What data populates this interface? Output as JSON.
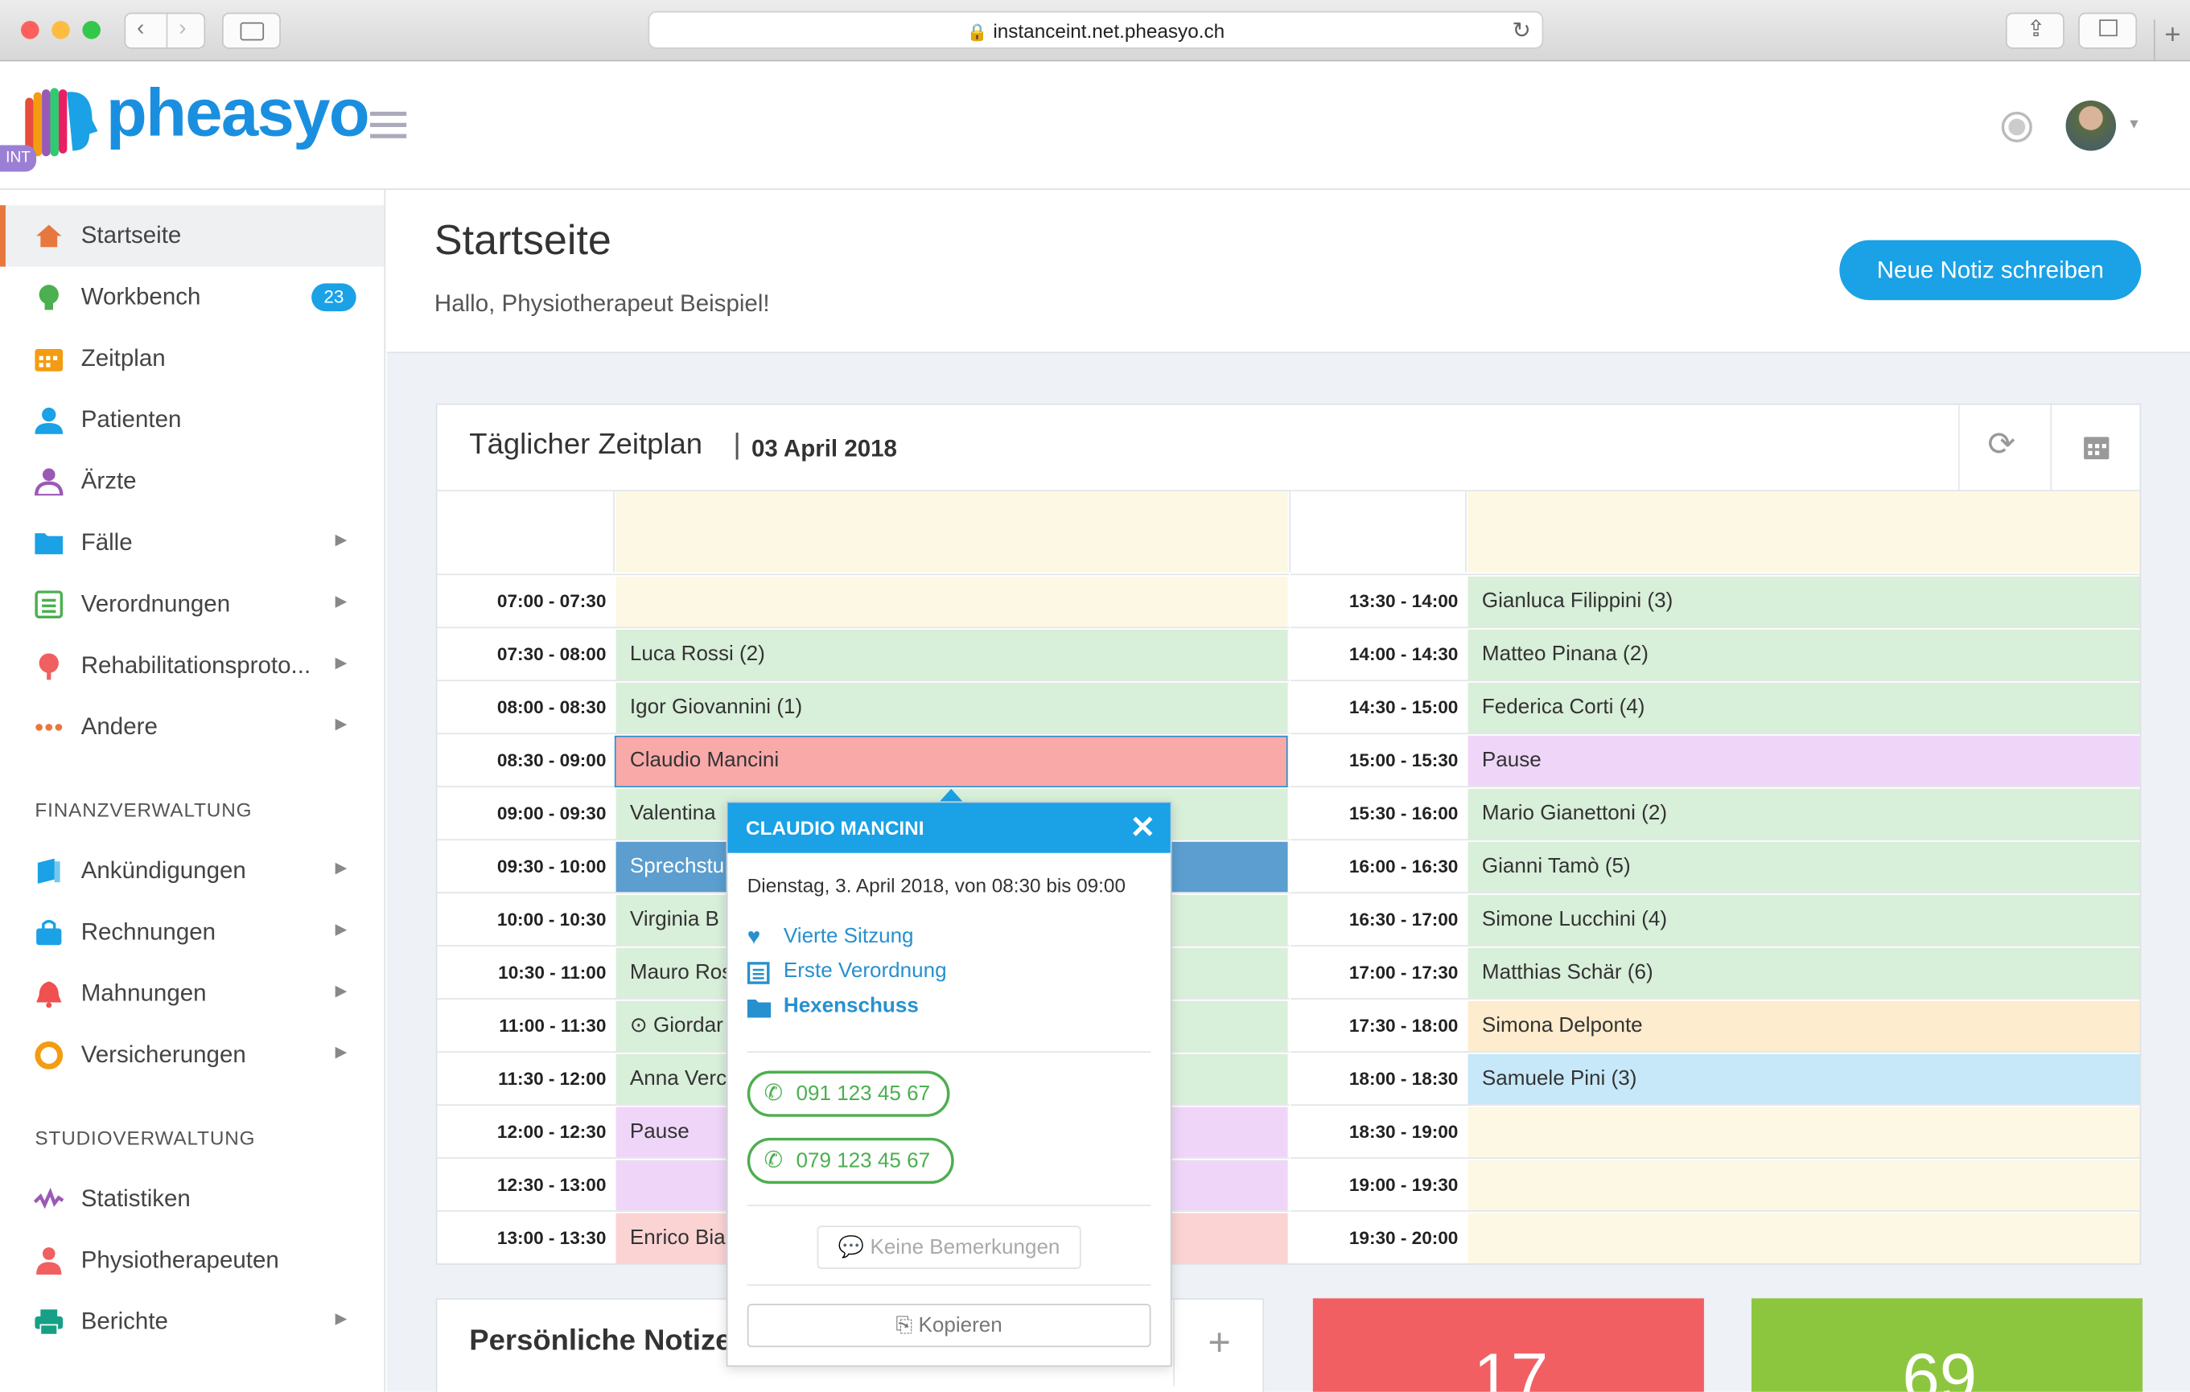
{
  "browser": {
    "url": "instanceint.net.pheasyo.ch"
  },
  "header": {
    "logo": "pheasyo",
    "badge": "INT"
  },
  "sidebar": {
    "items": [
      {
        "label": "Startseite",
        "icon": "home-icon",
        "color": "#e8773d"
      },
      {
        "label": "Workbench",
        "icon": "lightbulb-icon",
        "color": "#4caf50",
        "badge": "23"
      },
      {
        "label": "Zeitplan",
        "icon": "calendar-icon",
        "color": "#f39c12"
      },
      {
        "label": "Patienten",
        "icon": "user-icon",
        "color": "#1aa1e6"
      },
      {
        "label": "Ärzte",
        "icon": "doctor-icon",
        "color": "#9b59b6"
      },
      {
        "label": "Fälle",
        "icon": "folder-icon",
        "color": "#1aa1e6"
      },
      {
        "label": "Verordnungen",
        "icon": "list-icon",
        "color": "#4caf50"
      },
      {
        "label": "Rehabilitationsproto...",
        "icon": "tree-icon",
        "color": "#f06060"
      },
      {
        "label": "Andere",
        "icon": "dots-icon",
        "color": "#e8773d"
      }
    ],
    "section_finance": "FINANZVERWALTUNG",
    "finance_items": [
      {
        "label": "Ankündigungen",
        "icon": "book-icon",
        "color": "#1aa1e6"
      },
      {
        "label": "Rechnungen",
        "icon": "bag-icon",
        "color": "#1aa1e6"
      },
      {
        "label": "Mahnungen",
        "icon": "bell-icon",
        "color": "#f05050"
      },
      {
        "label": "Versicherungen",
        "icon": "lifebuoy-icon",
        "color": "#f39c12"
      }
    ],
    "section_studio": "STUDIOVERWALTUNG",
    "studio_items": [
      {
        "label": "Statistiken",
        "icon": "wave-icon",
        "color": "#9b59b6"
      },
      {
        "label": "Physiotherapeuten",
        "icon": "therapist-icon",
        "color": "#f06060"
      },
      {
        "label": "Berichte",
        "icon": "printer-icon",
        "color": "#16a085"
      }
    ]
  },
  "page": {
    "title": "Startseite",
    "greeting": "Hallo, Physiotherapeut Beispiel!",
    "new_note_button": "Neue Notiz schreiben"
  },
  "schedule": {
    "title": "Täglicher Zeitplan",
    "separator": "|",
    "date": "03 April 2018",
    "left": [
      {
        "time": "07:00 - 07:30",
        "text": "",
        "color": "yellow"
      },
      {
        "time": "07:30 - 08:00",
        "text": "Luca Rossi (2)",
        "color": "green"
      },
      {
        "time": "08:00 - 08:30",
        "text": "Igor Giovannini (1)",
        "color": "green"
      },
      {
        "time": "08:30 - 09:00",
        "text": "Claudio Mancini",
        "color": "red"
      },
      {
        "time": "09:00 - 09:30",
        "text": "Valentina",
        "color": "green"
      },
      {
        "time": "09:30 - 10:00",
        "text": "Sprechstu",
        "color": "blue"
      },
      {
        "time": "10:00 - 10:30",
        "text": "Virginia B",
        "color": "green"
      },
      {
        "time": "10:30 - 11:00",
        "text": "Mauro Ros",
        "color": "green"
      },
      {
        "time": "11:00 - 11:30",
        "text": "⊙ Giordar",
        "color": "green"
      },
      {
        "time": "11:30 - 12:00",
        "text": "Anna Verc",
        "color": "green"
      },
      {
        "time": "12:00 - 12:30",
        "text": "Pause",
        "color": "purple"
      },
      {
        "time": "12:30 - 13:00",
        "text": "",
        "color": "purple"
      },
      {
        "time": "13:00 - 13:30",
        "text": "Enrico Bia",
        "color": "pink"
      }
    ],
    "right": [
      {
        "time": "13:30 - 14:00",
        "text": "Gianluca Filippini (3)",
        "color": "green"
      },
      {
        "time": "14:00 - 14:30",
        "text": "Matteo Pinana (2)",
        "color": "green"
      },
      {
        "time": "14:30 - 15:00",
        "text": "Federica Corti (4)",
        "color": "green"
      },
      {
        "time": "15:00 - 15:30",
        "text": "Pause",
        "color": "purple"
      },
      {
        "time": "15:30 - 16:00",
        "text": "Mario Gianettoni (2)",
        "color": "green"
      },
      {
        "time": "16:00 - 16:30",
        "text": "Gianni Tamò (5)",
        "color": "green"
      },
      {
        "time": "16:30 - 17:00",
        "text": "Simone Lucchini (4)",
        "color": "green"
      },
      {
        "time": "17:00 - 17:30",
        "text": "Matthias Schär (6)",
        "color": "green"
      },
      {
        "time": "17:30 - 18:00",
        "text": "Simona Delponte",
        "color": "orange"
      },
      {
        "time": "18:00 - 18:30",
        "text": "Samuele Pini (3)",
        "color": "lightblue"
      },
      {
        "time": "18:30 - 19:00",
        "text": "",
        "color": "yellow"
      },
      {
        "time": "19:00 - 19:30",
        "text": "",
        "color": "yellow"
      },
      {
        "time": "19:30 - 20:00",
        "text": "",
        "color": "yellow"
      }
    ]
  },
  "popup": {
    "name": "CLAUDIO MANCINI",
    "datetime": "Dienstag, 3. April 2018, von 08:30 bis 09:00",
    "session": "Vierte Sitzung",
    "prescription": "Erste Verordnung",
    "case": "Hexenschuss",
    "phone1": "091 123 45 67",
    "phone2": "079 123 45 67",
    "remarks": "Keine Bemerkungen",
    "copy": "Kopieren"
  },
  "notes": {
    "title": "Persönliche Notize",
    "add": "+"
  },
  "cards": {
    "red_value": "17",
    "green_value": "69"
  }
}
